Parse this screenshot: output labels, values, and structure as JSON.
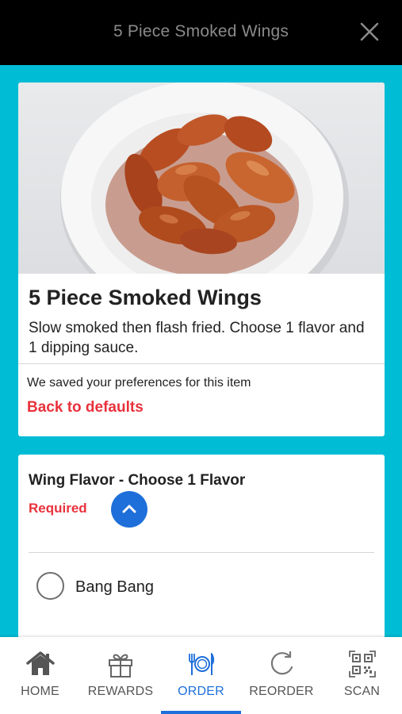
{
  "header": {
    "title": "5 Piece Smoked Wings",
    "close_icon": "close-icon"
  },
  "item": {
    "image_icon": "wings-photo",
    "title": "5 Piece Smoked Wings",
    "description": "Slow smoked then flash fried. Choose 1 flavor and 1 dipping sauce.",
    "preferences_note": "We saved your preferences for this item",
    "defaults_link": "Back to defaults"
  },
  "modifier_group": {
    "title": "Wing Flavor - Choose 1 Flavor",
    "required_label": "Required",
    "collapse_icon": "chevron-up-icon",
    "options": [
      {
        "label": "Bang Bang",
        "selected": false
      }
    ]
  },
  "bottom_nav": {
    "active": "ORDER",
    "items": [
      {
        "label": "HOME",
        "icon": "home-icon"
      },
      {
        "label": "REWARDS",
        "icon": "gift-icon"
      },
      {
        "label": "ORDER",
        "icon": "utensils-icon"
      },
      {
        "label": "REORDER",
        "icon": "refresh-icon"
      },
      {
        "label": "SCAN",
        "icon": "qr-code-icon"
      }
    ]
  },
  "colors": {
    "accent": "#1e6fd9",
    "alert": "#e8323c",
    "background": "#00bcd4",
    "topbar": "#000000"
  }
}
